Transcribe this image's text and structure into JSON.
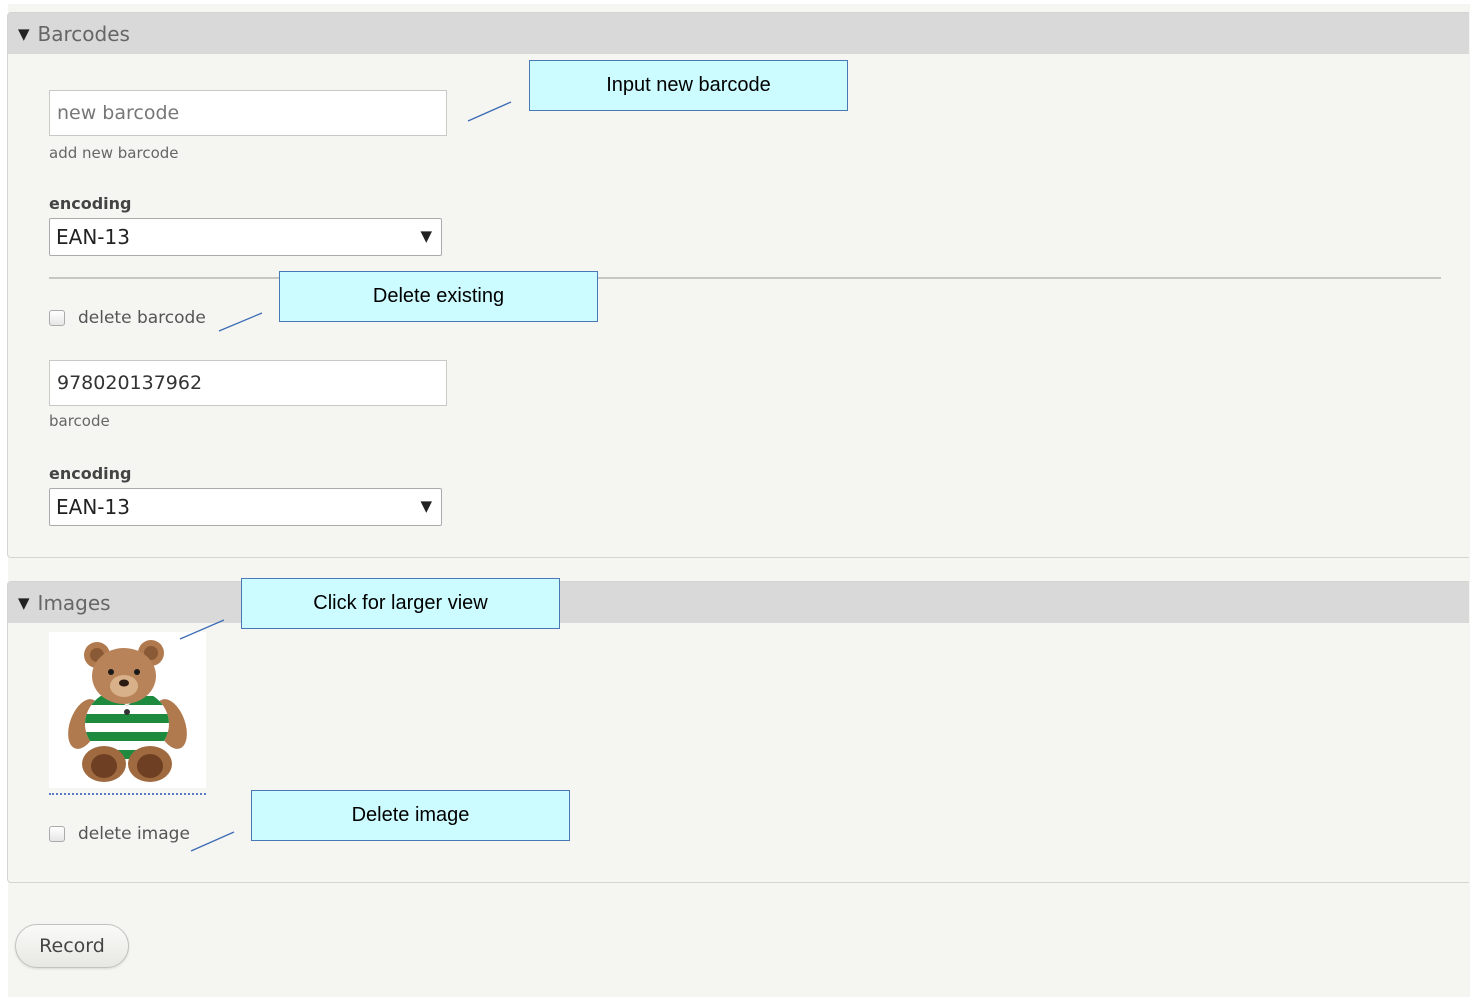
{
  "barcodes": {
    "legend": "Barcodes",
    "new_input": {
      "value": "",
      "placeholder": "new barcode"
    },
    "new_description": "add new barcode",
    "new_encoding_label": "encoding",
    "new_encoding_value": "EAN-13",
    "delete_label": "delete barcode",
    "existing_input": {
      "value": "978020137962",
      "placeholder": ""
    },
    "existing_description": "barcode",
    "existing_encoding_label": "encoding",
    "existing_encoding_value": "EAN-13"
  },
  "images": {
    "legend": "Images",
    "thumbnail_icon": "teddy-bear-image",
    "delete_label": "delete image"
  },
  "callouts": {
    "input_new_barcode": "Input new barcode",
    "delete_existing": "Delete existing",
    "click_larger_view": "Click for larger view",
    "delete_image": "Delete image"
  },
  "actions": {
    "record_label": "Record"
  },
  "icons": {
    "collapse": "triangle-down-icon",
    "select_arrow": "triangle-down-icon"
  },
  "colors": {
    "callout_fill": "#ccfcff",
    "callout_border": "#4a78b5",
    "legend_bg": "#d9d9d9"
  }
}
